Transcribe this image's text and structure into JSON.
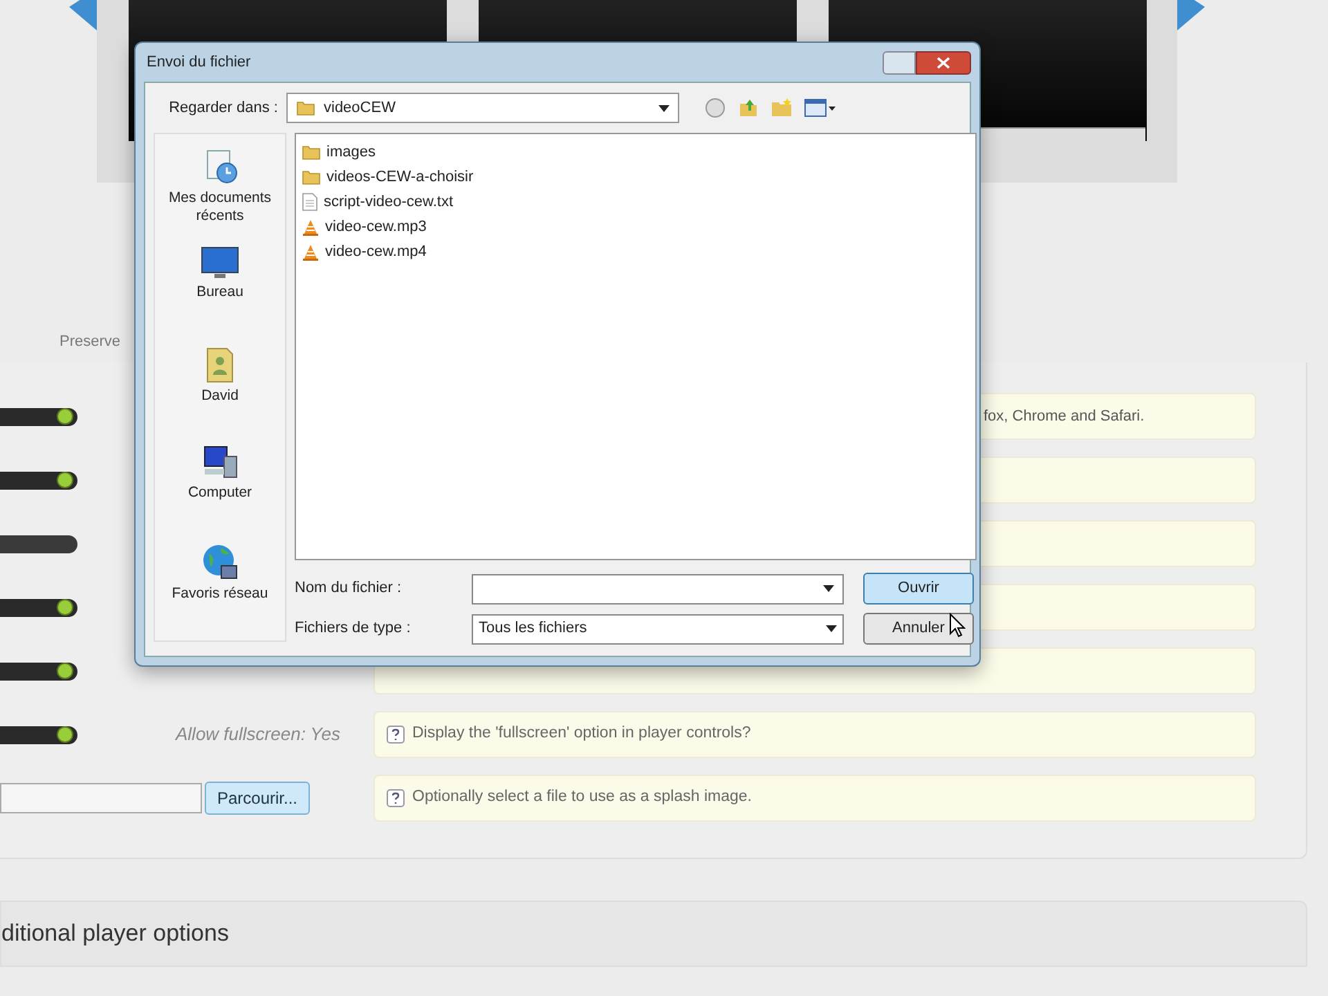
{
  "video_strip": {
    "screens": [
      {
        "kind": "blank"
      },
      {
        "kind": "blank"
      },
      {
        "kind": "player"
      }
    ]
  },
  "preserve_label": "Preserve",
  "options": [
    {
      "kind": "toggle",
      "on": true,
      "hint": "fox, Chrome and Safari.",
      "hint_cut": true
    },
    {
      "kind": "toggle",
      "on": true
    },
    {
      "kind": "toggle",
      "on": false
    },
    {
      "kind": "toggle",
      "on": true
    },
    {
      "kind": "toggle",
      "on": true
    },
    {
      "kind": "toggle",
      "on": true,
      "label": "Allow fullscreen: Yes",
      "hint": "Display the 'fullscreen' option in player controls?",
      "hint_cut": false
    },
    {
      "kind": "file",
      "button": "Parcourir...",
      "hint": "Optionally select a file to use as a splash image.",
      "hint_cut": false
    }
  ],
  "section_title": "ditional player options",
  "dialog": {
    "title": "Envoi du fichier",
    "look_in_label": "Regarder dans :",
    "look_in_value": "videoCEW",
    "places": [
      {
        "kind": "recent",
        "label": "Mes documents récents"
      },
      {
        "kind": "desktop",
        "label": "Bureau"
      },
      {
        "kind": "user",
        "label": "David"
      },
      {
        "kind": "computer",
        "label": "Computer"
      },
      {
        "kind": "network",
        "label": "Favoris réseau"
      }
    ],
    "files": [
      {
        "kind": "folder",
        "name": "images"
      },
      {
        "kind": "folder",
        "name": "videos-CEW-a-choisir"
      },
      {
        "kind": "text",
        "name": "script-video-cew.txt"
      },
      {
        "kind": "media",
        "name": "video-cew.mp3"
      },
      {
        "kind": "media",
        "name": "video-cew.mp4"
      }
    ],
    "file_name_label": "Nom du fichier :",
    "file_type_label": "Fichiers de type :",
    "file_type_value": "Tous les fichiers",
    "buttons": [
      {
        "label": "Ouvrir",
        "default": true
      },
      {
        "label": "Annuler",
        "default": false
      }
    ]
  }
}
